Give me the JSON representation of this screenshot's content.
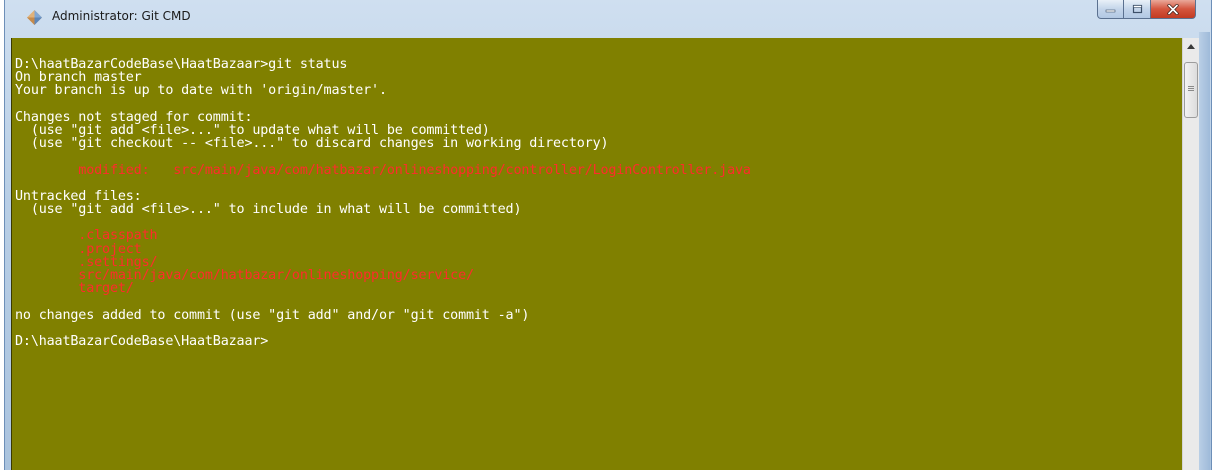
{
  "window": {
    "title": "Administrator: Git CMD",
    "icon": "git-icon",
    "controls": [
      "minimize-icon",
      "maximize-icon",
      "close-icon"
    ]
  },
  "terminal": {
    "background": "#808000",
    "text_color": "#ffffff",
    "highlight_color": "#ff2b2b",
    "lines": [
      {
        "text": "D:\\haatBazarCodeBase\\HaatBazaar>git status",
        "color": "white"
      },
      {
        "text": "On branch master",
        "color": "white"
      },
      {
        "text": "Your branch is up to date with 'origin/master'.",
        "color": "white"
      },
      {
        "text": "",
        "color": "white"
      },
      {
        "text": "Changes not staged for commit:",
        "color": "white"
      },
      {
        "text": "  (use \"git add <file>...\" to update what will be committed)",
        "color": "white"
      },
      {
        "text": "  (use \"git checkout -- <file>...\" to discard changes in working directory)",
        "color": "white"
      },
      {
        "text": "",
        "color": "white"
      },
      {
        "text": "        modified:   src/main/java/com/hatbazar/onlineshopping/controller/LoginController.java",
        "color": "red"
      },
      {
        "text": "",
        "color": "white"
      },
      {
        "text": "Untracked files:",
        "color": "white"
      },
      {
        "text": "  (use \"git add <file>...\" to include in what will be committed)",
        "color": "white"
      },
      {
        "text": "",
        "color": "white"
      },
      {
        "text": "        .classpath",
        "color": "red"
      },
      {
        "text": "        .project",
        "color": "red"
      },
      {
        "text": "        .settings/",
        "color": "red"
      },
      {
        "text": "        src/main/java/com/hatbazar/onlineshopping/service/",
        "color": "red"
      },
      {
        "text": "        target/",
        "color": "red"
      },
      {
        "text": "",
        "color": "white"
      },
      {
        "text": "no changes added to commit (use \"git add\" and/or \"git commit -a\")",
        "color": "white"
      },
      {
        "text": "",
        "color": "white"
      },
      {
        "text": "D:\\haatBazarCodeBase\\HaatBazaar>",
        "color": "white"
      }
    ]
  },
  "scrollbar": {
    "up_arrow": "scroll-up-arrow-icon"
  }
}
